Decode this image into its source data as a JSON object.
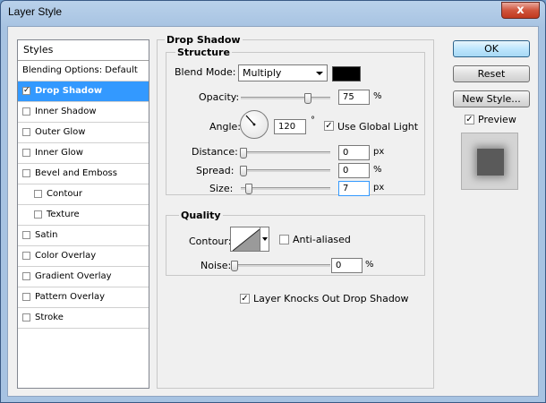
{
  "window": {
    "title": "Layer Style",
    "close_glyph": "x"
  },
  "styles": {
    "header": "Styles",
    "items": [
      {
        "label": "Blending Options: Default",
        "checkbox": false,
        "checked": false,
        "indent": 0
      },
      {
        "label": "Drop Shadow",
        "checkbox": true,
        "checked": true,
        "indent": 0,
        "selected": true
      },
      {
        "label": "Inner Shadow",
        "checkbox": true,
        "checked": false,
        "indent": 0
      },
      {
        "label": "Outer Glow",
        "checkbox": true,
        "checked": false,
        "indent": 0
      },
      {
        "label": "Inner Glow",
        "checkbox": true,
        "checked": false,
        "indent": 0
      },
      {
        "label": "Bevel and Emboss",
        "checkbox": true,
        "checked": false,
        "indent": 0
      },
      {
        "label": "Contour",
        "checkbox": true,
        "checked": false,
        "indent": 1
      },
      {
        "label": "Texture",
        "checkbox": true,
        "checked": false,
        "indent": 1
      },
      {
        "label": "Satin",
        "checkbox": true,
        "checked": false,
        "indent": 0
      },
      {
        "label": "Color Overlay",
        "checkbox": true,
        "checked": false,
        "indent": 0
      },
      {
        "label": "Gradient Overlay",
        "checkbox": true,
        "checked": false,
        "indent": 0
      },
      {
        "label": "Pattern Overlay",
        "checkbox": true,
        "checked": false,
        "indent": 0
      },
      {
        "label": "Stroke",
        "checkbox": true,
        "checked": false,
        "indent": 0
      }
    ]
  },
  "drop_shadow": {
    "section_title": "Drop Shadow",
    "structure": {
      "title": "Structure",
      "blend_mode_label": "Blend Mode:",
      "blend_mode_value": "Multiply",
      "shadow_color": "#000000",
      "opacity_label": "Opacity:",
      "opacity_value": "75",
      "opacity_unit": "%",
      "opacity_fraction": 0.75,
      "angle_label": "Angle:",
      "angle_value": "120",
      "angle_unit": "°",
      "use_global_light_label": "Use Global Light",
      "use_global_light_checked": true,
      "distance_label": "Distance:",
      "distance_value": "0",
      "distance_unit": "px",
      "spread_label": "Spread:",
      "spread_value": "0",
      "spread_unit": "%",
      "size_label": "Size:",
      "size_value": "7",
      "size_unit": "px"
    },
    "quality": {
      "title": "Quality",
      "contour_label": "Contour:",
      "anti_aliased_label": "Anti-aliased",
      "anti_aliased_checked": false,
      "noise_label": "Noise:",
      "noise_value": "0",
      "noise_unit": "%"
    },
    "knocks_out_label": "Layer Knocks Out Drop Shadow",
    "knocks_out_checked": true
  },
  "buttons": {
    "ok": "OK",
    "reset": "Reset",
    "new_style": "New Style..."
  },
  "preview": {
    "label": "Preview",
    "checked": true
  },
  "check_glyph": "✓",
  "colors": {
    "selection": "#3399ff",
    "accent_border": "#2c628b"
  }
}
